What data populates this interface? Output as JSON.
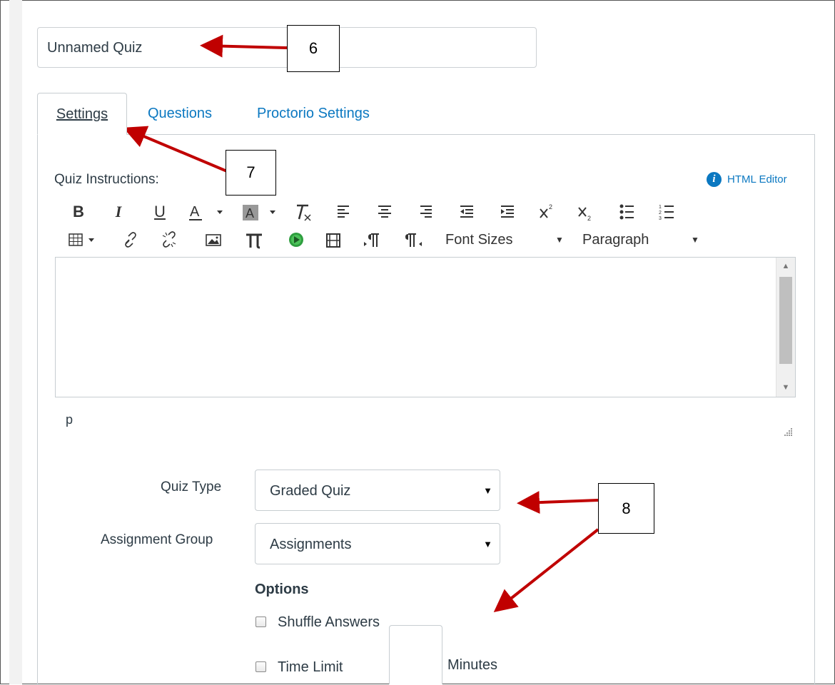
{
  "quiz_title": "Unnamed Quiz",
  "tabs": [
    {
      "label": "Settings",
      "active": true
    },
    {
      "label": "Questions",
      "active": false
    },
    {
      "label": "Proctorio Settings",
      "active": false
    }
  ],
  "instructions_label": "Quiz Instructions:",
  "html_editor_link": "HTML Editor",
  "info_icon_glyph": "i",
  "toolbar": {
    "bold": "B",
    "italic": "I",
    "underline": "U",
    "font_sizes": "Font Sizes",
    "paragraph": "Paragraph"
  },
  "status_path": "p",
  "quiz_type": {
    "label": "Quiz Type",
    "value": "Graded Quiz"
  },
  "assignment_group": {
    "label": "Assignment Group",
    "value": "Assignments"
  },
  "options": {
    "heading": "Options",
    "shuffle_answers": "Shuffle Answers",
    "time_limit": "Time Limit",
    "minutes": "Minutes"
  },
  "callouts": [
    "6",
    "7",
    "8"
  ],
  "colors": {
    "link": "#0b78c1",
    "arrow": "#c00000",
    "border": "#c7cdd1"
  }
}
